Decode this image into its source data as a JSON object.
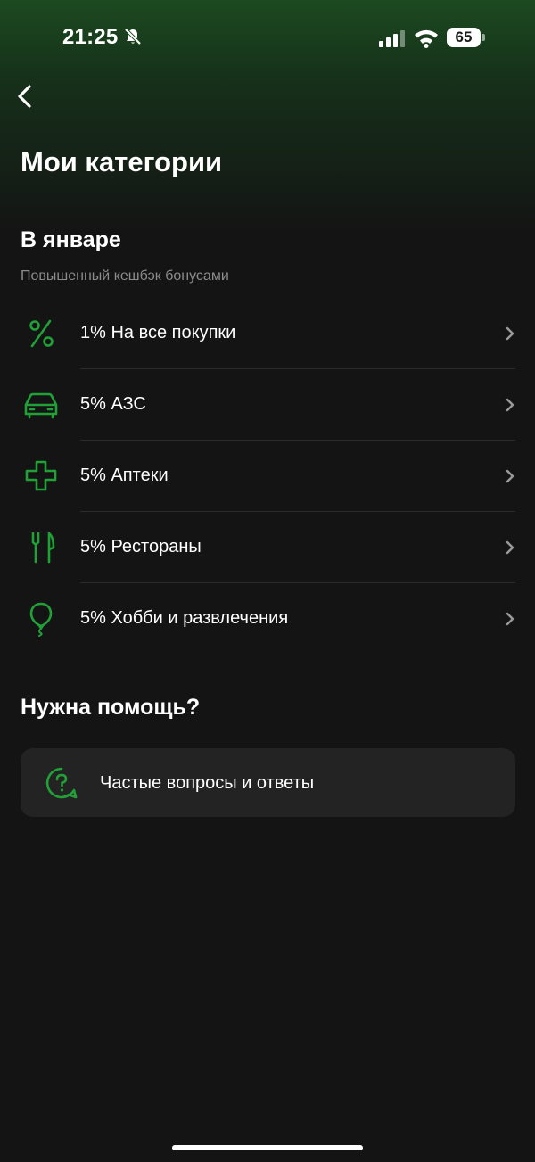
{
  "status_bar": {
    "time": "21:25",
    "battery": "65"
  },
  "page": {
    "title": "Мои категории"
  },
  "january": {
    "title": "В январе",
    "subtitle": "Повышенный кешбэк бонусами",
    "categories": [
      {
        "label": "1% На все покупки",
        "icon": "percent-icon"
      },
      {
        "label": "5% АЗС",
        "icon": "car-icon"
      },
      {
        "label": "5% Аптеки",
        "icon": "pharmacy-cross-icon"
      },
      {
        "label": "5% Рестораны",
        "icon": "fork-knife-icon"
      },
      {
        "label": "5% Хобби и развлечения",
        "icon": "balloon-icon"
      }
    ]
  },
  "help": {
    "title": "Нужна помощь?",
    "faq_label": "Частые вопросы и ответы",
    "faq_icon": "question-chat-icon"
  },
  "colors": {
    "accent_green": "#21a038",
    "background": "#141414",
    "card": "#232323",
    "muted_text": "#8c8c8c"
  }
}
